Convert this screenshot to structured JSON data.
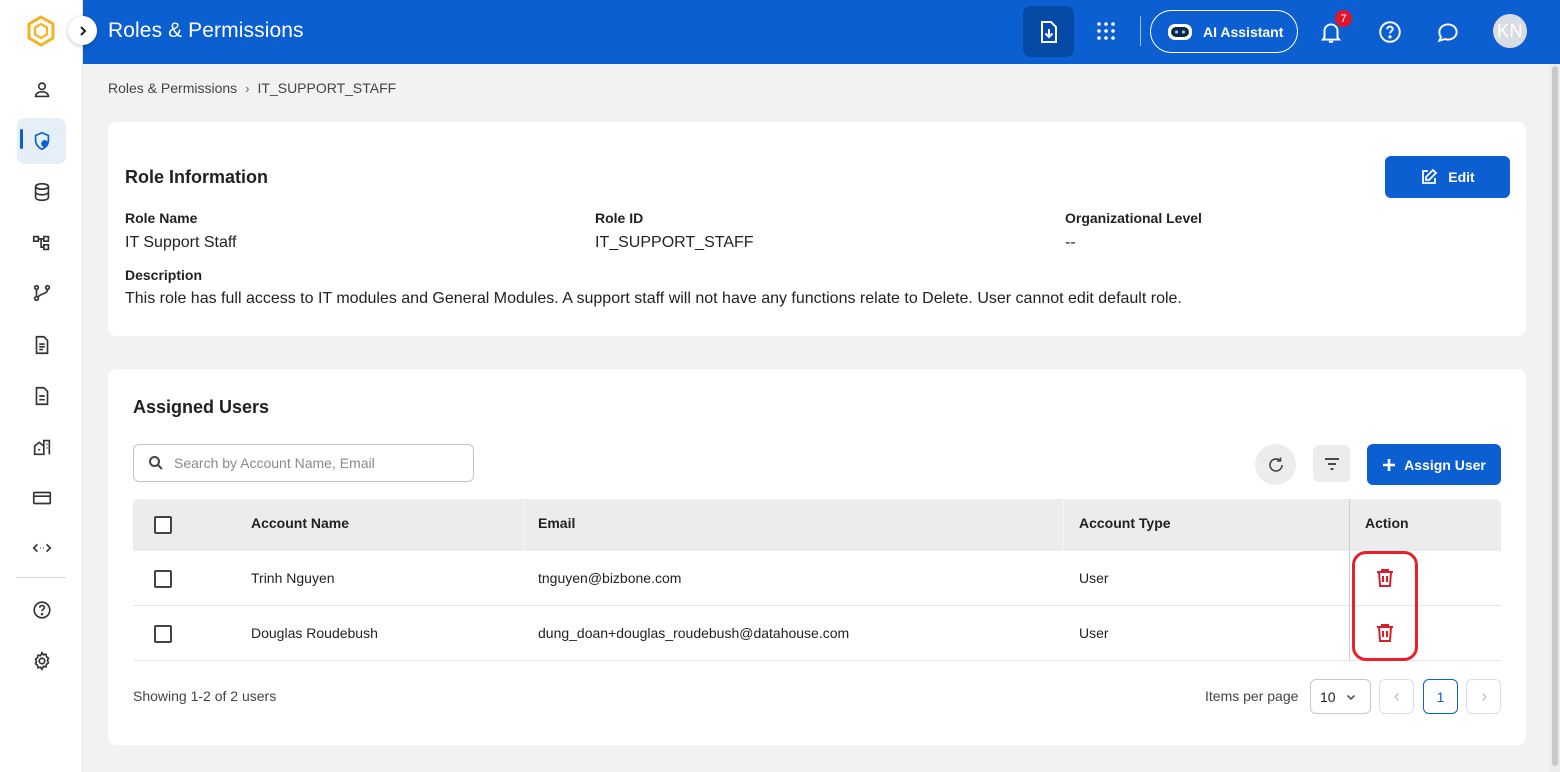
{
  "header": {
    "title": "Roles & Permissions",
    "ai_label": "AI Assistant",
    "notification_count": "7",
    "avatar_initials": "KN",
    "accent": "#0b5fd1"
  },
  "breadcrumb": {
    "root": "Roles & Permissions",
    "separator": "›",
    "current": "IT_SUPPORT_STAFF"
  },
  "role_info": {
    "title": "Role Information",
    "edit_label": "Edit",
    "role_name_label": "Role Name",
    "role_name": "IT Support Staff",
    "role_id_label": "Role ID",
    "role_id": "IT_SUPPORT_STAFF",
    "org_level_label": "Organizational Level",
    "org_level": "--",
    "description_label": "Description",
    "description": "This role has full access to IT modules and General Modules. A support staff will not have any functions relate to Delete. User cannot edit default role."
  },
  "users": {
    "title": "Assigned Users",
    "search_placeholder": "Search by Account Name, Email",
    "assign_label": "Assign User",
    "columns": {
      "account_name": "Account Name",
      "email": "Email",
      "account_type": "Account Type",
      "action": "Action"
    },
    "rows": [
      {
        "name": "Trinh Nguyen",
        "email": "tnguyen@bizbone.com",
        "type": "User"
      },
      {
        "name": "Douglas Roudebush",
        "email": "dung_doan+douglas_roudebush@datahouse.com",
        "type": "User"
      }
    ],
    "showing": "Showing 1-2 of 2 users",
    "items_per_page_label": "Items per page",
    "items_per_page": "10",
    "current_page": "1"
  },
  "sidebar": {
    "icons": [
      "user-icon",
      "shield-icon",
      "database-icon",
      "workflow-icon",
      "git-icon",
      "document-icon",
      "report-icon",
      "building-icon",
      "card-icon",
      "code-icon",
      "help-icon",
      "settings-icon"
    ]
  }
}
